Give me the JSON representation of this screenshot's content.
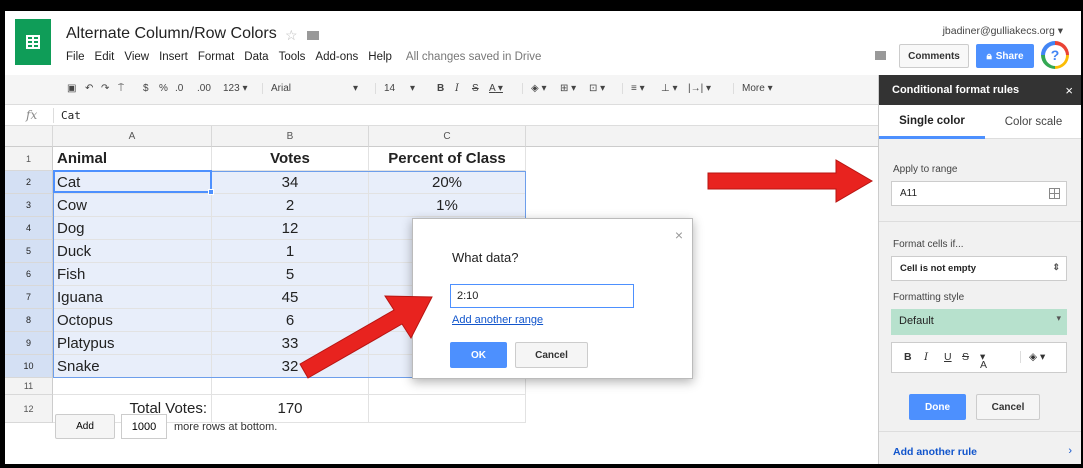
{
  "header": {
    "title": "Alternate Column/Row Colors",
    "user_email": "jbadiner@gulliakecs.org",
    "comments_label": "Comments",
    "share_label": "Share",
    "help_label": "?",
    "menu": [
      "File",
      "Edit",
      "View",
      "Insert",
      "Format",
      "Data",
      "Tools",
      "Add-ons",
      "Help"
    ],
    "saved_status": "All changes saved in Drive"
  },
  "toolbar": {
    "currency": "$",
    "percent": "%",
    "dec_less": ".0",
    "dec_more": ".00",
    "num_format": "123",
    "font": "Arial",
    "font_size": "14",
    "bold": "B",
    "italic": "I",
    "strike": "S",
    "text_color": "A",
    "more": "More"
  },
  "formula_bar": {
    "fx": "fx",
    "value": "Cat"
  },
  "sheet": {
    "columns": [
      "A",
      "B",
      "C"
    ],
    "headers": [
      "Animal",
      "Votes",
      "Percent of Class"
    ],
    "rows": [
      {
        "num": "1"
      },
      {
        "num": "2",
        "animal": "Cat",
        "votes": "34",
        "percent": "20%"
      },
      {
        "num": "3",
        "animal": "Cow",
        "votes": "2",
        "percent": "1%"
      },
      {
        "num": "4",
        "animal": "Dog",
        "votes": "12",
        "percent": ""
      },
      {
        "num": "5",
        "animal": "Duck",
        "votes": "1",
        "percent": ""
      },
      {
        "num": "6",
        "animal": "Fish",
        "votes": "5",
        "percent": ""
      },
      {
        "num": "7",
        "animal": "Iguana",
        "votes": "45",
        "percent": ""
      },
      {
        "num": "8",
        "animal": "Octopus",
        "votes": "6",
        "percent": ""
      },
      {
        "num": "9",
        "animal": "Platypus",
        "votes": "33",
        "percent": ""
      },
      {
        "num": "10",
        "animal": "Snake",
        "votes": "32",
        "percent": ""
      },
      {
        "num": "11"
      },
      {
        "num": "12"
      }
    ],
    "total_label": "Total Votes:",
    "total_value": "170",
    "add_label": "Add",
    "add_rows_value": "1000",
    "add_rows_text": "more rows at bottom."
  },
  "dialog": {
    "title": "What data?",
    "close": "×",
    "range_value": "2:10",
    "add_range": "Add another range",
    "ok": "OK",
    "cancel": "Cancel"
  },
  "panel": {
    "title": "Conditional format rules",
    "close": "×",
    "tab_single": "Single color",
    "tab_scale": "Color scale",
    "apply_label": "Apply to range",
    "range": "A11",
    "format_if_label": "Format cells if...",
    "condition": "Cell is not empty",
    "style_label": "Formatting style",
    "style_value": "Default",
    "done": "Done",
    "cancel": "Cancel",
    "add_rule": "Add another rule",
    "style_buttons": {
      "bold": "B",
      "italic": "I",
      "underline": "U",
      "strike": "S",
      "color": "A"
    }
  },
  "colors": {
    "accent": "#4d90fe",
    "sheets_green": "#0f9d58",
    "selection": "#e8eefa",
    "style_preview": "#b7e1cd",
    "arrow": "#e8231f"
  }
}
